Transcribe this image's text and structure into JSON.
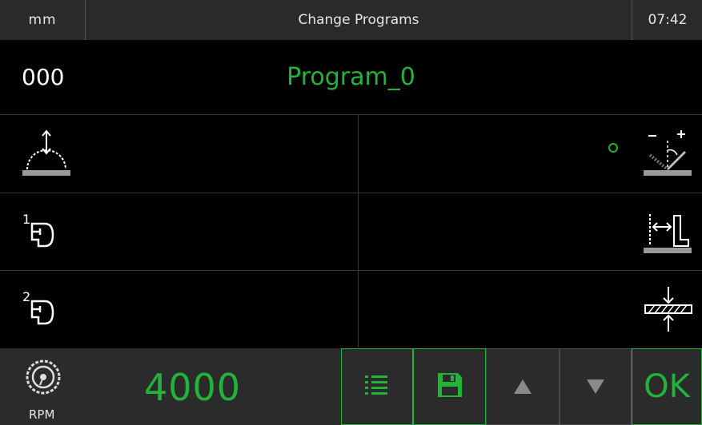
{
  "header": {
    "unit": "mm",
    "title": "Change Programs",
    "time": "07:42"
  },
  "program": {
    "number": "000",
    "name": "Program_0"
  },
  "rows": [
    {
      "left_icon": "blade-height-icon",
      "right_icon": "blade-tilt-angle-icon",
      "status": "active-indicator"
    },
    {
      "left_icon": "clamp-1-icon",
      "right_icon": "fence-position-icon"
    },
    {
      "left_icon": "clamp-2-icon",
      "right_icon": "material-thickness-icon"
    }
  ],
  "footer": {
    "rpm_label": "RPM",
    "rpm_value": "4000",
    "ok_label": "OK",
    "buttons": [
      "list-icon",
      "save-icon",
      "arrow-up-icon",
      "arrow-down-icon"
    ]
  },
  "colors": {
    "accent": "#22b33a",
    "header_bg": "#2a2a2a",
    "footer_bg": "#2b2b2b",
    "text": "#e6e6e6"
  }
}
